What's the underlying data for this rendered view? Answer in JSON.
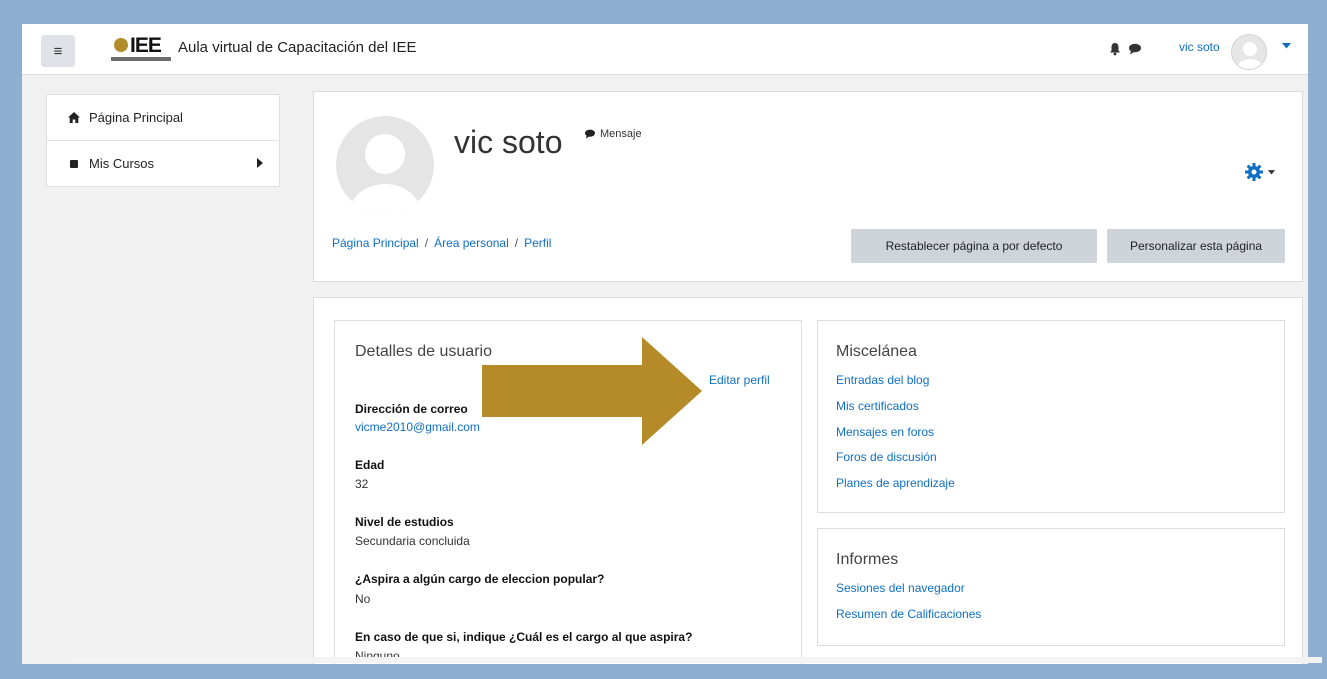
{
  "navbar": {
    "logo_text": "IEE",
    "site_name": "Aula virtual de Capacitación del IEE",
    "username": "vic soto"
  },
  "leftnav": {
    "items": [
      {
        "label": "Página Principal",
        "icon": "home-icon"
      },
      {
        "label": "Mis Cursos",
        "icon": "square-icon"
      }
    ]
  },
  "profile": {
    "name": "vic soto",
    "message_label": "Mensaje",
    "breadcrumb": [
      "Página Principal",
      "Área personal",
      "Perfil"
    ],
    "reset_button": "Restablecer página a por defecto",
    "customize_button": "Personalizar esta página"
  },
  "details": {
    "title": "Detalles de usuario",
    "edit_link": "Editar perfil",
    "fields": [
      {
        "label": "Dirección de correo",
        "value": "vicme2010@gmail.com"
      },
      {
        "label": "Edad",
        "value": "32"
      },
      {
        "label": "Nivel de estudios",
        "value": "Secundaria concluida"
      },
      {
        "label": "¿Aspira a algún cargo de eleccion popular?",
        "value": "No"
      },
      {
        "label": "En caso de que si, indique ¿Cuál es el cargo al que aspira?",
        "value": "Ninguno"
      }
    ]
  },
  "misc": {
    "title": "Miscelánea",
    "links": [
      "Entradas del blog",
      "Mis certificados",
      "Mensajes en foros",
      "Foros de discusión",
      "Planes de aprendizaje"
    ]
  },
  "reports": {
    "title": "Informes",
    "links": [
      "Sesiones del navegador",
      "Resumen de Calificaciones"
    ]
  },
  "colors": {
    "link": "#0f6fc5",
    "arrow": "#b58a28",
    "background": "#8fafd1",
    "button": "#ced4da"
  }
}
